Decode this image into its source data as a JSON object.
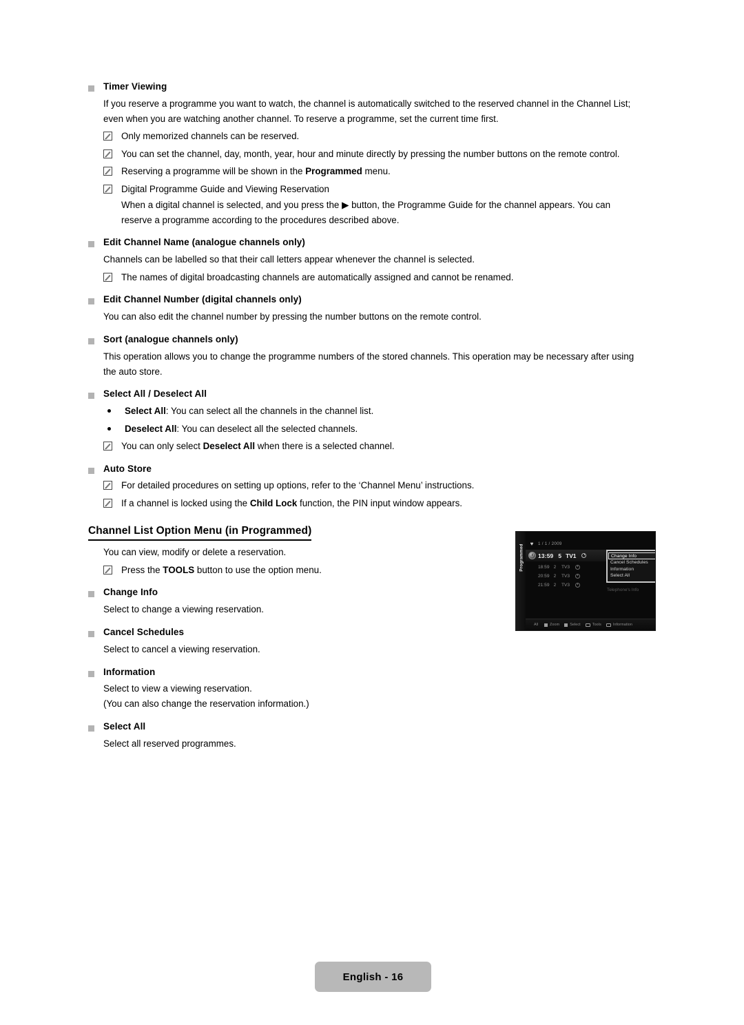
{
  "page": {
    "footer_label": "English - 16"
  },
  "sections": [
    {
      "heading": "Timer Viewing",
      "para1": "If you reserve a programme you want to watch, the channel is automatically switched to the reserved channel in the Channel List;",
      "para2": "even when you are watching another channel. To reserve a programme, set the current time first.",
      "notes": [
        "Only memorized channels can be reserved.",
        "You can set the channel, day, month, year, hour and minute directly by pressing the number buttons on the remote control.",
        "Reserving a programme will be shown in the Programmed menu.",
        "Digital Programme Guide and Viewing Reservation"
      ],
      "note3_pre": "Reserving a programme will be shown in the ",
      "note3_bold": "Programmed",
      "note3_post": " menu.",
      "subnote_line1": "When a digital channel is selected, and you press the ▶ button, the Programme Guide for the channel appears. You can",
      "subnote_line2": "reserve a programme according to the procedures described above."
    },
    {
      "heading": "Edit Channel Name (analogue channels only)",
      "para": "Channels can be labelled so that their call letters appear whenever the channel is selected.",
      "note": "The names of digital broadcasting channels are automatically assigned and cannot be renamed."
    },
    {
      "heading": "Edit Channel Number (digital channels only)",
      "para": "You can also edit the channel number by pressing the number buttons on the remote control."
    },
    {
      "heading": "Sort (analogue channels only)",
      "para1": "This operation allows you to change the programme numbers of the stored channels. This operation may be necessary after using",
      "para2": "the auto store."
    },
    {
      "heading": "Select All / Deselect All",
      "bullet1_bold": "Select All",
      "bullet1_rest": ": You can select all the channels in the channel list.",
      "bullet2_bold": "Deselect All",
      "bullet2_rest": ": You can deselect all the selected channels.",
      "note_pre": "You can only select ",
      "note_bold": "Deselect All",
      "note_post": " when there is a selected channel."
    },
    {
      "heading": "Auto Store",
      "note1": "For detailed procedures on setting up options, refer to the ‘Channel Menu’ instructions.",
      "note2_pre": "If a channel is locked using the ",
      "note2_bold": "Child Lock",
      "note2_post": " function, the PIN input window appears."
    }
  ],
  "main_heading": "Channel List Option Menu (in Programmed)",
  "main_intro": "You can view, modify or delete a reservation.",
  "main_note_pre": "Press the ",
  "main_note_bold": "TOOLS",
  "main_note_post": " button to use the option menu.",
  "option_items": [
    {
      "heading": "Change Info",
      "desc": "Select to change a viewing reservation."
    },
    {
      "heading": "Cancel Schedules",
      "desc": "Select to cancel a viewing reservation."
    },
    {
      "heading": "Information",
      "desc": "Select to view a viewing reservation.",
      "desc2": "(You can also change the reservation information.)"
    },
    {
      "heading": "Select All",
      "desc": "Select all reserved programmes."
    }
  ],
  "tv_screenshot": {
    "side_label": "Programmed",
    "date": "1 / 1 / 2009",
    "selected_row": {
      "time": "13:59",
      "num": "5",
      "channel": "TV1"
    },
    "rows": [
      {
        "time": "18:59",
        "num": "2",
        "channel": "TV3"
      },
      {
        "time": "20:59",
        "num": "2",
        "channel": "TV3"
      },
      {
        "time": "21:59",
        "num": "2",
        "channel": "TV3"
      }
    ],
    "ghost_text": "Telephone's Info",
    "popup_items": [
      "Change Info",
      "Cancel Schedules",
      "Information",
      "Select All"
    ],
    "popup_selected": "Change Info",
    "help_bar": {
      "all": "All",
      "items": [
        "Zoom",
        "Select",
        "Tools",
        "Information"
      ]
    }
  }
}
